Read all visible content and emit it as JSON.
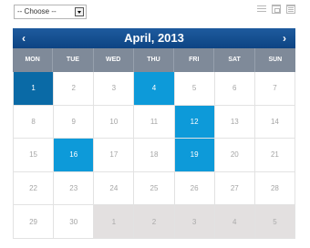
{
  "filter": {
    "selected": "-- Choose --"
  },
  "view_icons": [
    "list-view-icon",
    "week-view-icon",
    "month-view-icon"
  ],
  "calendar": {
    "title": "April, 2013",
    "prev_icon": "‹",
    "next_icon": "›",
    "weekdays": [
      "MON",
      "TUE",
      "WED",
      "THU",
      "FRI",
      "SAT",
      "SUN"
    ],
    "days": [
      {
        "label": "1",
        "state": "event-today"
      },
      {
        "label": "2",
        "state": "normal"
      },
      {
        "label": "3",
        "state": "normal"
      },
      {
        "label": "4",
        "state": "event"
      },
      {
        "label": "5",
        "state": "normal"
      },
      {
        "label": "6",
        "state": "normal"
      },
      {
        "label": "7",
        "state": "normal"
      },
      {
        "label": "8",
        "state": "normal"
      },
      {
        "label": "9",
        "state": "normal"
      },
      {
        "label": "10",
        "state": "normal"
      },
      {
        "label": "11",
        "state": "normal"
      },
      {
        "label": "12",
        "state": "event"
      },
      {
        "label": "13",
        "state": "normal"
      },
      {
        "label": "14",
        "state": "normal"
      },
      {
        "label": "15",
        "state": "normal"
      },
      {
        "label": "16",
        "state": "event"
      },
      {
        "label": "17",
        "state": "normal"
      },
      {
        "label": "18",
        "state": "normal"
      },
      {
        "label": "19",
        "state": "event"
      },
      {
        "label": "20",
        "state": "normal"
      },
      {
        "label": "21",
        "state": "normal"
      },
      {
        "label": "22",
        "state": "normal"
      },
      {
        "label": "23",
        "state": "normal"
      },
      {
        "label": "24",
        "state": "normal"
      },
      {
        "label": "25",
        "state": "normal"
      },
      {
        "label": "26",
        "state": "normal"
      },
      {
        "label": "27",
        "state": "normal"
      },
      {
        "label": "28",
        "state": "normal"
      },
      {
        "label": "29",
        "state": "normal"
      },
      {
        "label": "30",
        "state": "normal"
      },
      {
        "label": "1",
        "state": "other-month"
      },
      {
        "label": "2",
        "state": "other-month"
      },
      {
        "label": "3",
        "state": "other-month"
      },
      {
        "label": "4",
        "state": "other-month"
      },
      {
        "label": "5",
        "state": "other-month"
      }
    ]
  },
  "colors": {
    "header": "#0d4483",
    "weekday_bar": "#7f8a99",
    "event": "#0d9ad9",
    "event_today": "#0a6aa6",
    "other_month": "#e3e0e0"
  }
}
